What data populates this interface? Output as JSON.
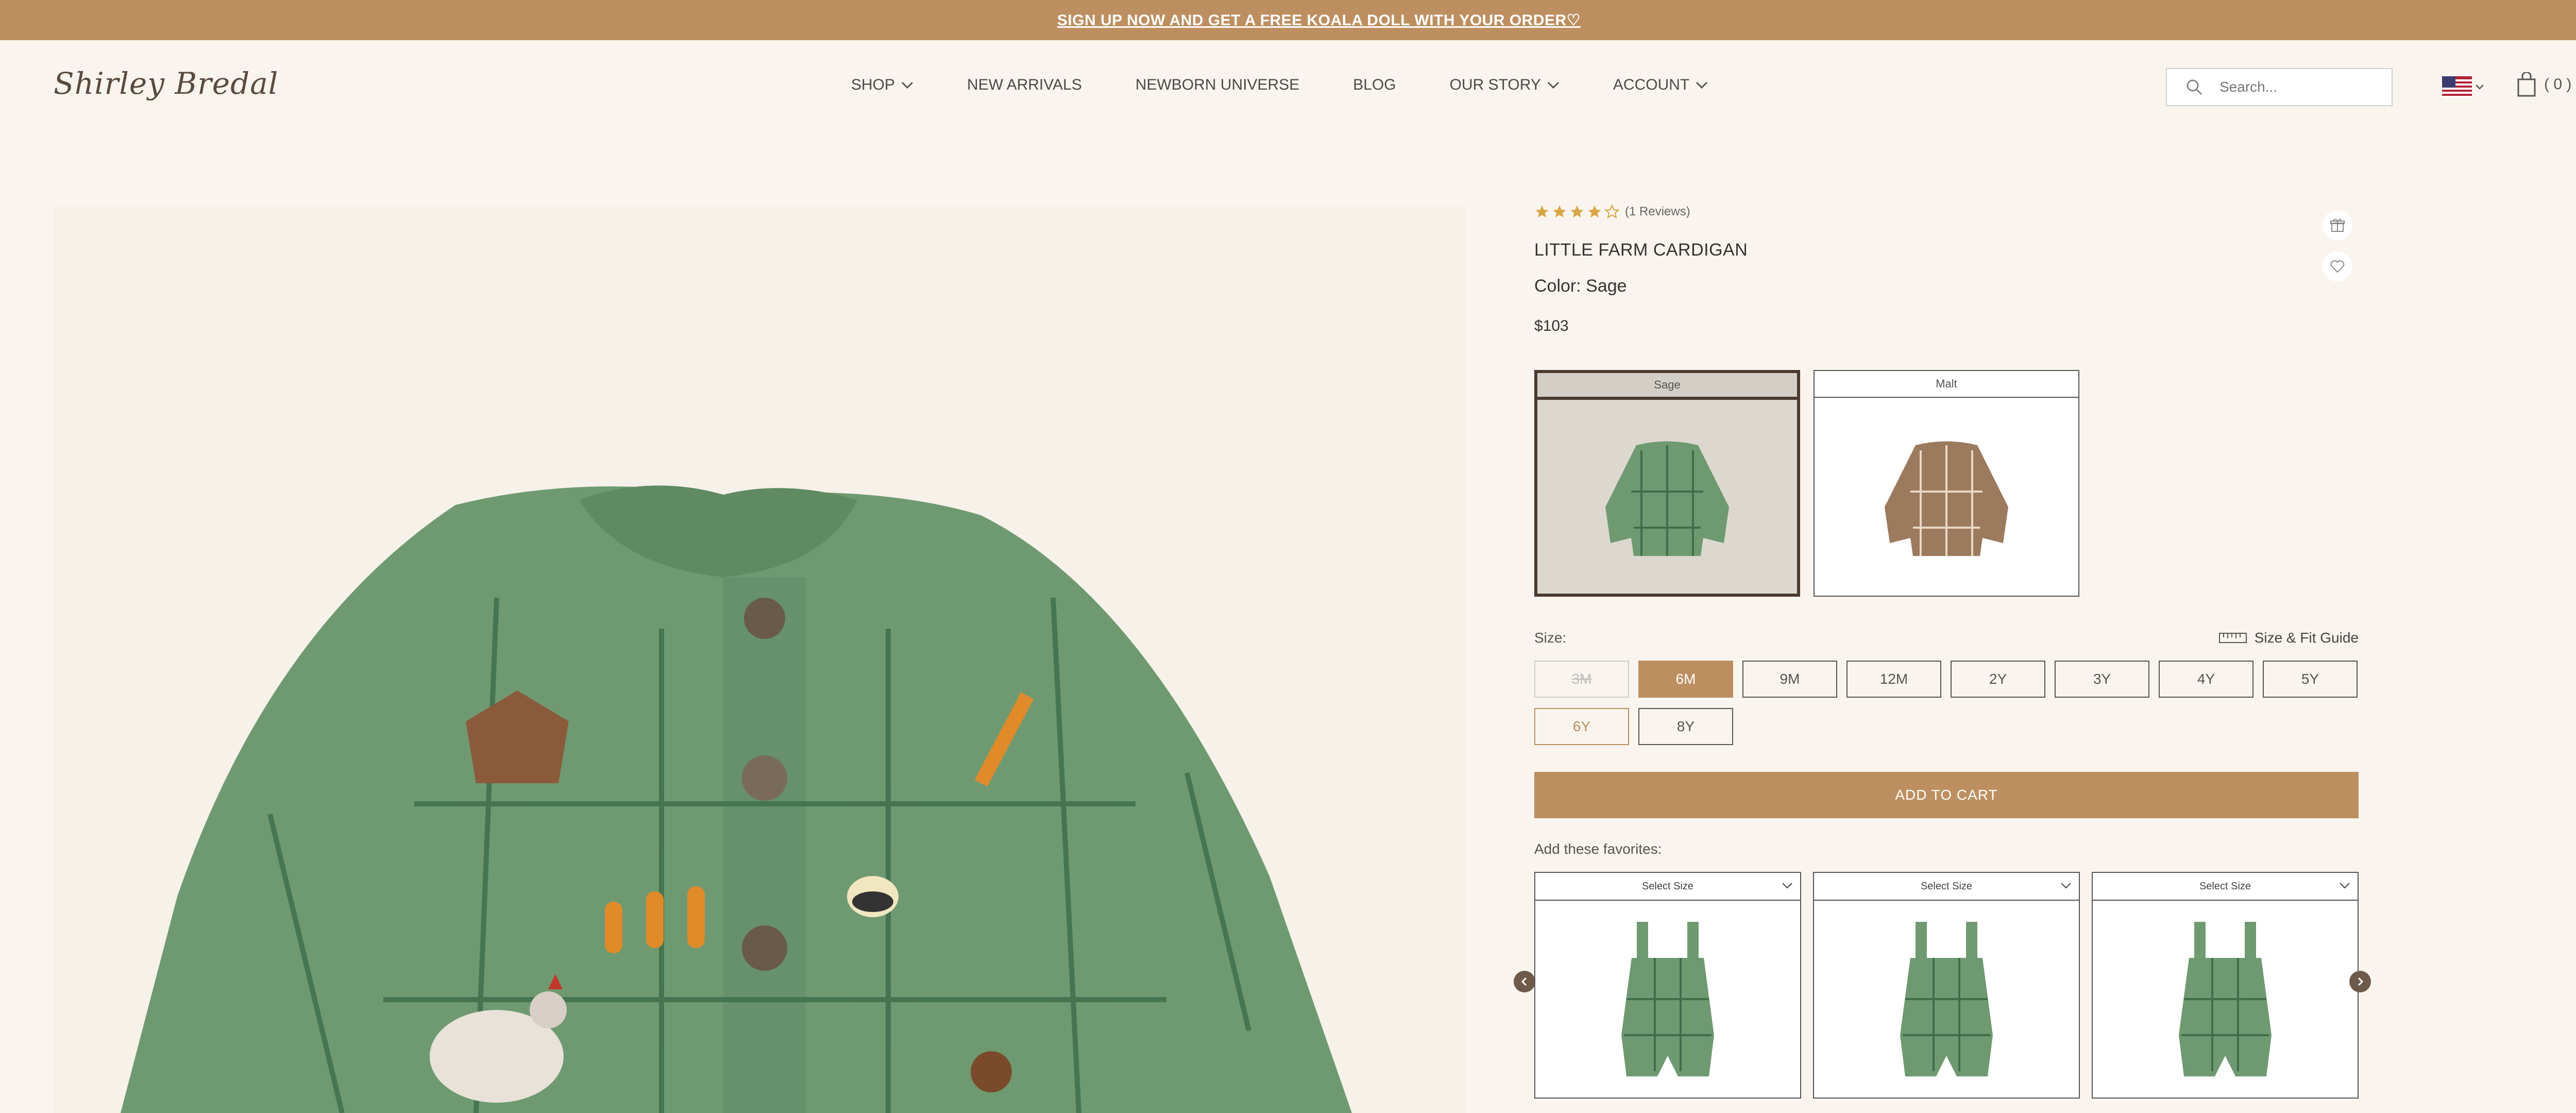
{
  "announcement": "SIGN UP NOW AND GET A FREE KOALA DOLL WITH YOUR ORDER♡",
  "brand": "Shirley Bredal",
  "nav": [
    {
      "label": "SHOP",
      "dropdown": true
    },
    {
      "label": "NEW ARRIVALS",
      "dropdown": false
    },
    {
      "label": "NEWBORN UNIVERSE",
      "dropdown": false
    },
    {
      "label": "BLOG",
      "dropdown": false
    },
    {
      "label": "OUR STORY",
      "dropdown": true
    },
    {
      "label": "ACCOUNT",
      "dropdown": true
    }
  ],
  "search": {
    "placeholder": "Search..."
  },
  "cart": {
    "count": "( 0 )"
  },
  "product": {
    "rating": 4,
    "reviews": "(1 Reviews)",
    "title": "LITTLE FARM CARDIGAN",
    "color": "Color: Sage",
    "price": "$103"
  },
  "swatches": [
    {
      "label": "Sage",
      "selected": true,
      "color": "#6f9a71"
    },
    {
      "label": "Malt",
      "selected": false,
      "color": "#9c7a5e"
    }
  ],
  "size_label": "Size:",
  "size_guide": "Size & Fit Guide",
  "sizes": [
    {
      "label": "3M",
      "state": "disabled"
    },
    {
      "label": "6M",
      "state": "selected"
    },
    {
      "label": "9M",
      "state": "normal"
    },
    {
      "label": "12M",
      "state": "normal"
    },
    {
      "label": "2Y",
      "state": "normal"
    },
    {
      "label": "3Y",
      "state": "normal"
    },
    {
      "label": "4Y",
      "state": "normal"
    },
    {
      "label": "5Y",
      "state": "normal"
    },
    {
      "label": "6Y",
      "state": "accent"
    },
    {
      "label": "8Y",
      "state": "normal"
    }
  ],
  "add_to_cart": "ADD TO CART",
  "favorites_label": "Add these favorites:",
  "favorites": [
    {
      "select": "Select Size"
    },
    {
      "select": "Select Size"
    },
    {
      "select": "Select Size"
    }
  ],
  "colors": {
    "accent": "#bd8f60",
    "background": "#f9f5ee",
    "sage": "#6f9a71"
  }
}
